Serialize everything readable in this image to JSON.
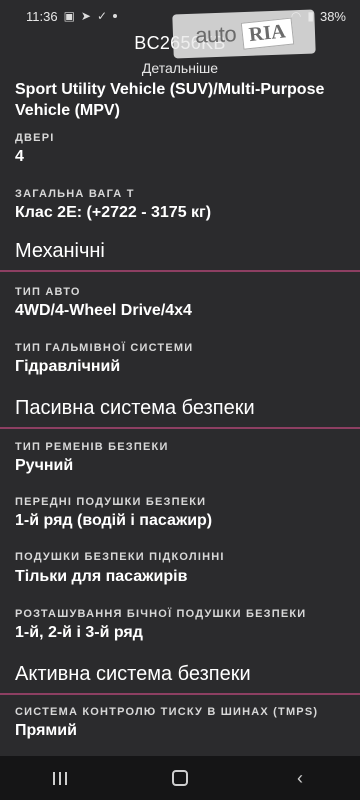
{
  "status_bar": {
    "time": "11:36",
    "battery": "38%"
  },
  "header": {
    "title": "BC2656KB",
    "subtitle": "Детальніше"
  },
  "watermark": {
    "brand_left": "auto",
    "brand_right": "RIA"
  },
  "content": {
    "continued_value": "Sport Utility Vehicle (SUV)/Multi-Purpose Vehicle (MPV)",
    "doors": {
      "label": "ДВЕРІ",
      "value": "4"
    },
    "gross_weight": {
      "label": "ЗАГАЛЬНА ВАГА Т",
      "value": "Клас 2E: (+2722 - 3175 кг)"
    }
  },
  "sections": {
    "mechanical": {
      "title": "Механічні",
      "drive_type": {
        "label": "ТИП АВТО",
        "value": "4WD/4-Wheel Drive/4x4"
      },
      "brake_type": {
        "label": "ТИП ГАЛЬМІВНОЇ СИСТЕМИ",
        "value": "Гідравлічний"
      }
    },
    "passive_safety": {
      "title": "Пасивна система безпеки",
      "seatbelt_type": {
        "label": "ТИП РЕМЕНІВ БЕЗПЕКИ",
        "value": "Ручний"
      },
      "front_airbags": {
        "label": "ПЕРЕДНІ ПОДУШКИ БЕЗПЕКИ",
        "value": "1-й ряд (водій і пасажир)"
      },
      "knee_airbags": {
        "label": "ПОДУШКИ БЕЗПЕКИ ПІДКОЛІННІ",
        "value": "Тільки для пасажирів"
      },
      "side_airbags": {
        "label": "РОЗТАШУВАННЯ БІЧНОЇ ПОДУШКИ БЕЗПЕКИ",
        "value": "1-й, 2-й і 3-й ряд"
      }
    },
    "active_safety": {
      "title": "Активна система безпеки",
      "tpms": {
        "label": "СИСТЕМА КОНТРОЛЮ ТИСКУ В ШИНАХ (TMPS)",
        "value": "Прямий"
      }
    }
  },
  "colors": {
    "background": "#2b2b2d",
    "divider": "#8d3f62"
  }
}
